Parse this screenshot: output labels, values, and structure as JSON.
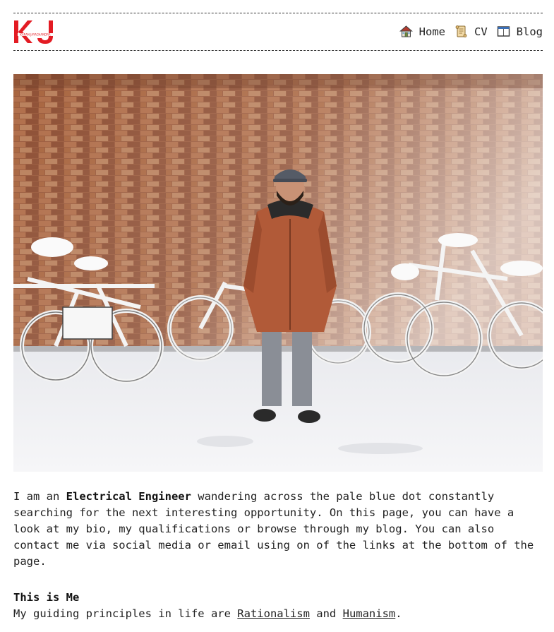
{
  "header": {
    "logo": {
      "monogram": "KJ",
      "name": "KARAN JAYACHANDRA",
      "color": "#e31b23"
    },
    "nav": [
      {
        "label": "Home",
        "icon": "house-icon"
      },
      {
        "label": "CV",
        "icon": "scroll-icon"
      },
      {
        "label": "Blog",
        "icon": "book-icon"
      }
    ]
  },
  "hero": {
    "subject": "person in snow in front of brick wall with bicycles"
  },
  "intro": {
    "prefix": "I am an ",
    "role": "Electrical Engineer",
    "text": " wandering across the pale blue dot constantly searching for the next interesting opportunity. On this page, you can have a look at my bio, my qualifications or browse through my blog. You can also contact me via social media or email using on of the links at the bottom of the page."
  },
  "about": {
    "title": "This is Me",
    "principles_prefix": "My guiding principles in life are ",
    "link1": "Rationalism",
    "conjunction": " and ",
    "link2": "Humanism",
    "suffix": "."
  }
}
